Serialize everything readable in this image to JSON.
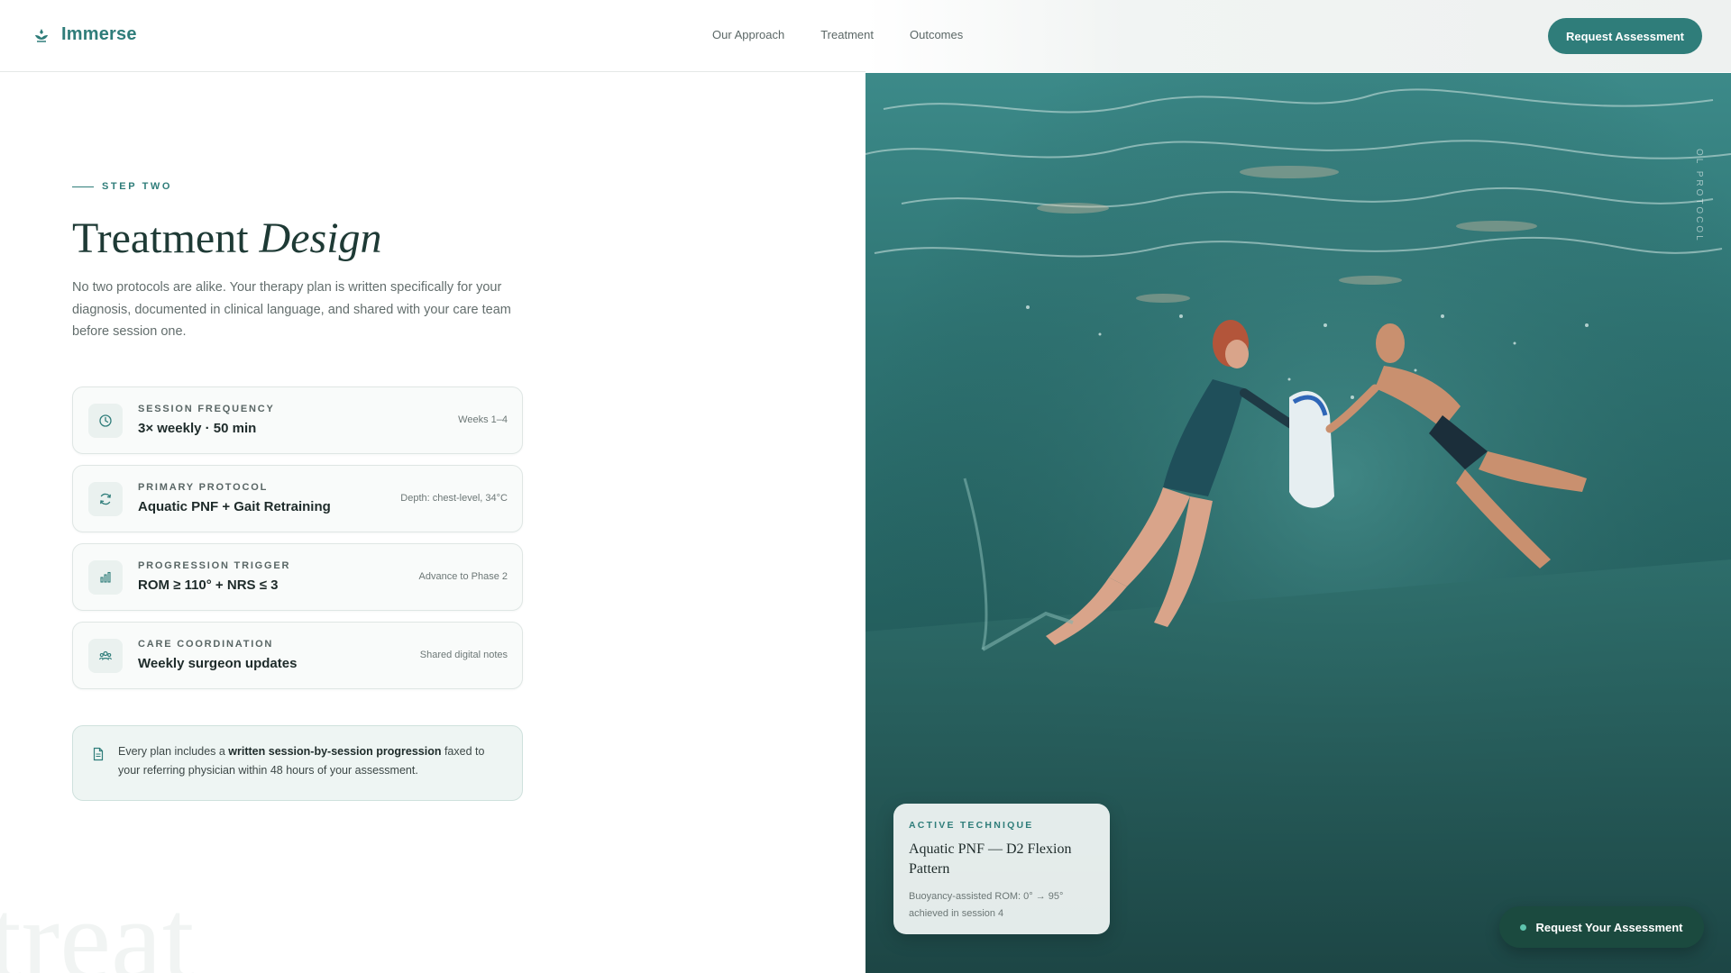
{
  "header": {
    "logo_text": "Immerse",
    "nav": [
      "Our Approach",
      "Treatment",
      "Outcomes"
    ],
    "cta_label": "Request Assessment"
  },
  "section": {
    "eyebrow": "STEP TWO",
    "title_plain": "Treatment",
    "title_italic": "Design",
    "intro": "No two protocols are alike. Your therapy plan is written specifically for your diagnosis, documented in clinical language, and shared with your care team before session one."
  },
  "cards": [
    {
      "icon": "clock-icon",
      "label": "SESSION FREQUENCY",
      "value": "3× weekly · 50 min",
      "meta": "Weeks 1–4"
    },
    {
      "icon": "refresh-icon",
      "label": "PRIMARY PROTOCOL",
      "value": "Aquatic PNF + Gait Retraining",
      "meta": "Depth: chest-level, 34°C"
    },
    {
      "icon": "bar-chart-icon",
      "label": "PROGRESSION TRIGGER",
      "value": "ROM ≥ 110° + NRS ≤ 3",
      "meta": "Advance to Phase 2"
    },
    {
      "icon": "team-icon",
      "label": "CARE COORDINATION",
      "value": "Weekly surgeon updates",
      "meta": "Shared digital notes"
    }
  ],
  "note": {
    "prefix": "Every plan includes a ",
    "bold": "written session-by-session progression",
    "suffix": " faxed to your referring physician within 48 hours of your assessment."
  },
  "watermark": "treat",
  "photo": {
    "vertical_label": "OL PROTOCOL",
    "technique_label": "ACTIVE TECHNIQUE",
    "technique_title": "Aquatic PNF — D2 Flexion Pattern",
    "technique_desc": "Buoyancy-assisted ROM: 0° → 95° achieved in session 4"
  },
  "float_cta": "Request Your Assessment",
  "colors": {
    "accent": "#2f7d7a",
    "dark": "#1b4a3f",
    "pool": "#2a6a6a"
  }
}
